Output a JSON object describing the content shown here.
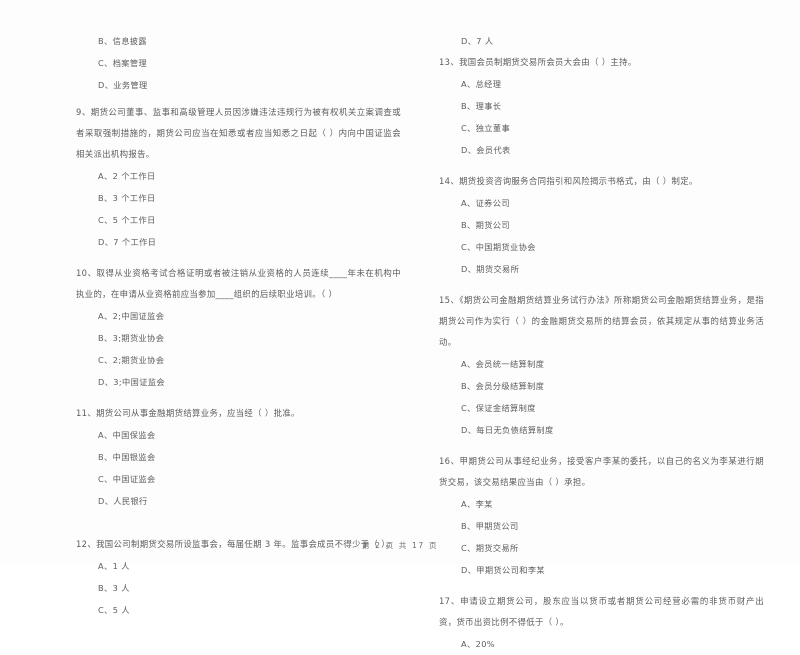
{
  "document": {
    "footer": "第 2 页  共 17 页",
    "page_number": "2",
    "total_pages": "17"
  },
  "left_column": {
    "continued_options": [
      "B、信息披露",
      "C、档案管理",
      "D、业务管理"
    ],
    "questions": [
      {
        "number": "9",
        "stem": "9、期货公司董事、监事和高级管理人员因涉嫌违法违规行为被有权机关立案调查或者采取强制措施的，期货公司应当在知悉或者应当知悉之日起（     ）内向中国证监会相关派出机构报告。",
        "options": [
          "A、2 个工作日",
          "B、3 个工作日",
          "C、5 个工作日",
          "D、7 个工作日"
        ]
      },
      {
        "number": "10",
        "stem": "10、取得从业资格考试合格证明或者被注销从业资格的人员连续____年未在机构中执业的，在申请从业资格前应当参加____组织的后续职业培训。（     ）",
        "options": [
          "A、2;中国证监会",
          "B、3;期货业协会",
          "C、2;期货业协会",
          "D、3;中国证监会"
        ]
      },
      {
        "number": "11",
        "stem": "11、期货公司从事金融期货结算业务，应当经（     ）批准。",
        "options": [
          "A、中国保监会",
          "B、中国银监会",
          "C、中国证监会",
          "D、人民银行"
        ]
      },
      {
        "number": "12",
        "stem": "12、我国公司制期货交易所设监事会，每届任期 3 年。监事会成员不得少于（     ）。",
        "options": [
          "A、1 人",
          "B、3 人",
          "C、5 人"
        ]
      }
    ]
  },
  "right_column": {
    "continued_options": [
      "D、7 人"
    ],
    "questions": [
      {
        "number": "13",
        "stem": "13、我国会员制期货交易所会员大会由（     ）主持。",
        "options": [
          "A、总经理",
          "B、理事长",
          "C、独立董事",
          "D、会员代表"
        ]
      },
      {
        "number": "14",
        "stem": "14、期货投资咨询服务合同指引和风险揭示书格式，由（     ）制定。",
        "options": [
          "A、证券公司",
          "B、期货公司",
          "C、中国期货业协会",
          "D、期货交易所"
        ]
      },
      {
        "number": "15",
        "stem": "15、《期货公司金融期货结算业务试行办法》所称期货公司金融期货结算业务，是指期货公司作为实行（     ）的金融期货交易所的结算会员，依其规定从事的结算业务活动。",
        "options": [
          "A、会员统一结算制度",
          "B、会员分级结算制度",
          "C、保证金结算制度",
          "D、每日无负债结算制度"
        ]
      },
      {
        "number": "16",
        "stem": "16、甲期货公司从事经纪业务，接受客户李某的委托，以自己的名义为李某进行期货交易，该交易结果应当由（     ）承担。",
        "options": [
          "A、李某",
          "B、甲期货公司",
          "C、期货交易所",
          "D、甲期货公司和李某"
        ]
      },
      {
        "number": "17",
        "stem": "17、申请设立期货公司，股东应当以货币或者期货公司经营必需的非货币财产出资，货币出资比例不得低于（     ）。",
        "options": [
          "A、20%"
        ]
      }
    ]
  }
}
